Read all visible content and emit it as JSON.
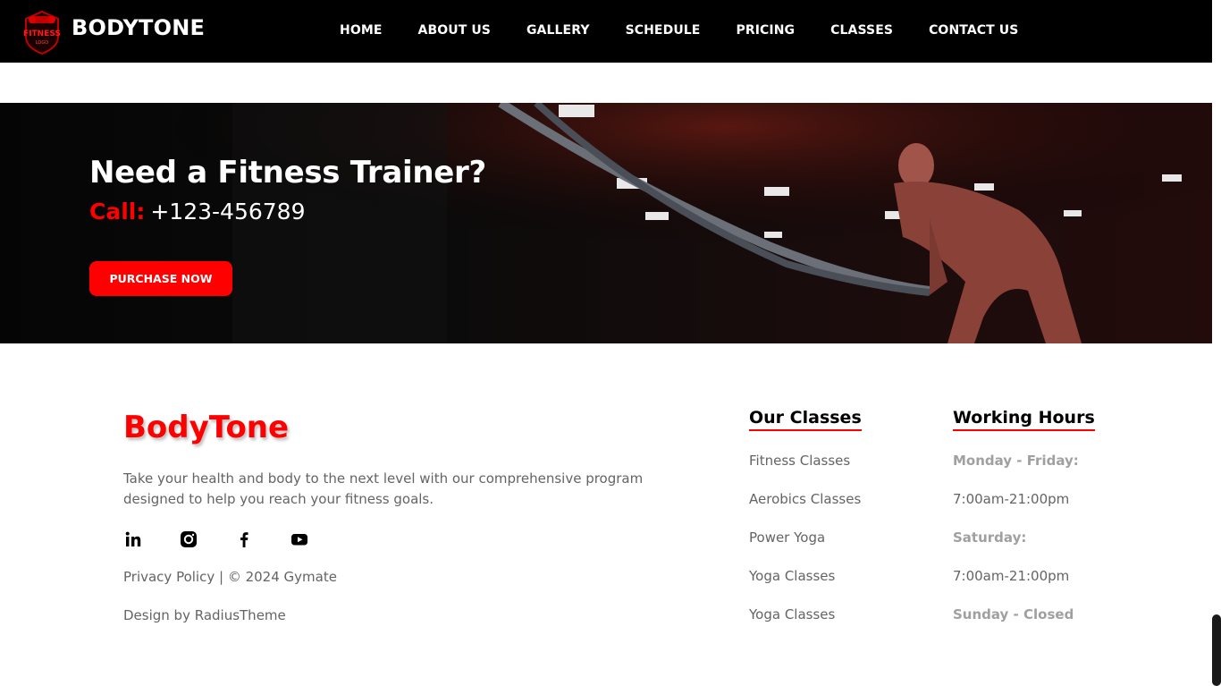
{
  "header": {
    "logo_text_top": "FITNESS",
    "logo_text_bottom": "LOGO",
    "brand": "BODYTONE",
    "nav": [
      "HOME",
      "ABOUT US",
      "GALLERY",
      "SCHEDULE",
      "PRICING",
      "CLASSES",
      "CONTACT US"
    ]
  },
  "hero": {
    "title": "Need a Fitness Trainer?",
    "call_label": "Call:",
    "phone": "+123-456789",
    "button": "PURCHASE NOW"
  },
  "footer": {
    "brand": "BodyTone",
    "description": "Take your health and body to the next level with our comprehensive program designed to help you reach your fitness goals.",
    "socials": [
      "linkedin-icon",
      "instagram-icon",
      "facebook-icon",
      "youtube-icon"
    ],
    "policy": "Privacy Policy | © 2024 Gymate",
    "design": "Design by RadiusTheme",
    "classes_title": "Our Classes",
    "classes": [
      "Fitness Classes",
      "Aerobics Classes",
      "Power Yoga",
      "Yoga Classes",
      "Yoga Classes"
    ],
    "hours_title": "Working Hours",
    "hours": [
      "Monday - Friday:",
      "7:00am-21:00pm",
      "Saturday:",
      "7:00am-21:00pm",
      "Sunday - Closed"
    ]
  },
  "colors": {
    "accent": "#ff0000",
    "dark": "#000000",
    "muted": "#646464"
  }
}
